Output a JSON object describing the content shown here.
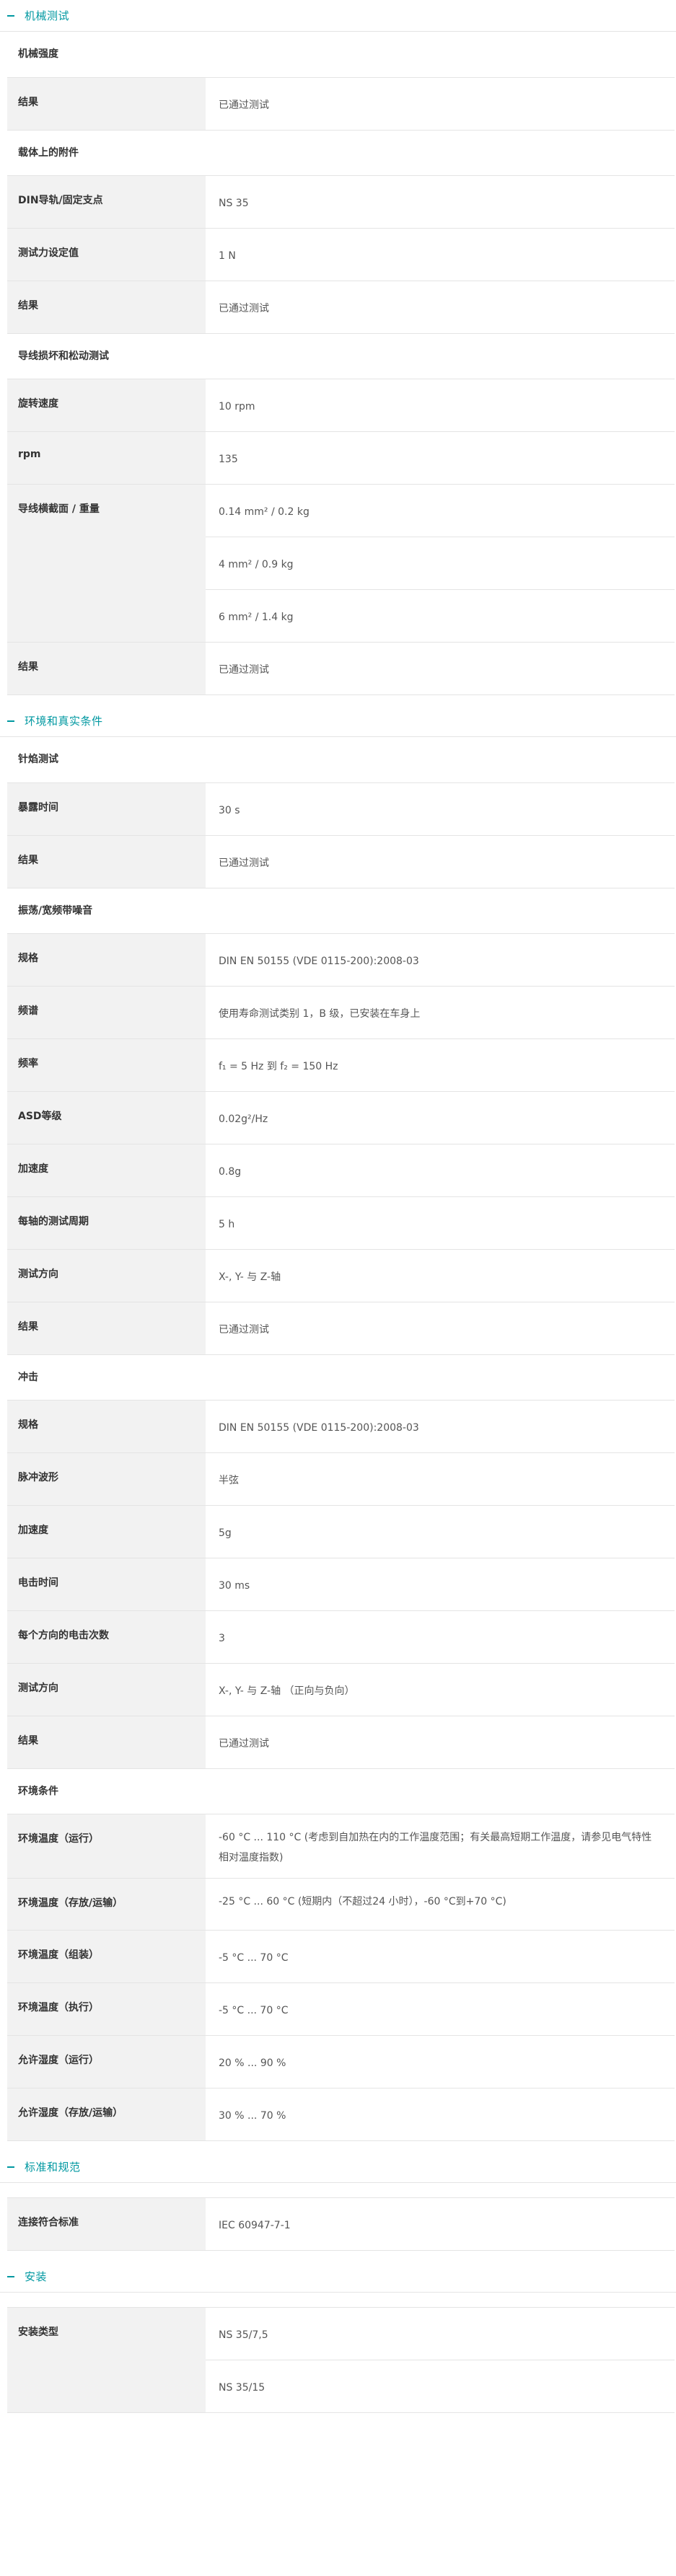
{
  "sections": [
    {
      "title": "机械测试",
      "groups": [
        {
          "title": "机械强度",
          "rows": [
            {
              "label": "结果",
              "values": [
                "已通过测试"
              ]
            }
          ]
        },
        {
          "title": "载体上的附件",
          "rows": [
            {
              "label": "DIN导轨/固定支点",
              "values": [
                "NS 35"
              ]
            },
            {
              "label": "测试力设定值",
              "values": [
                "1 N"
              ]
            },
            {
              "label": "结果",
              "values": [
                "已通过测试"
              ]
            }
          ]
        },
        {
          "title": "导线损坏和松动测试",
          "rows": [
            {
              "label": "旋转速度",
              "values": [
                "10 rpm"
              ]
            },
            {
              "label": "rpm",
              "values": [
                "135"
              ]
            },
            {
              "label": "导线横截面 / 重量",
              "values": [
                "0.14 mm² / 0.2 kg",
                "4 mm² / 0.9 kg",
                "6 mm² / 1.4 kg"
              ]
            },
            {
              "label": "结果",
              "values": [
                "已通过测试"
              ]
            }
          ]
        }
      ]
    },
    {
      "title": "环境和真实条件",
      "groups": [
        {
          "title": "针焰测试",
          "rows": [
            {
              "label": "暴露时间",
              "values": [
                "30 s"
              ]
            },
            {
              "label": "结果",
              "values": [
                "已通过测试"
              ]
            }
          ]
        },
        {
          "title": "振荡/宽频带噪音",
          "rows": [
            {
              "label": "规格",
              "values": [
                "DIN EN 50155 (VDE 0115-200):2008-03"
              ]
            },
            {
              "label": "频谱",
              "values": [
                "使用寿命测试类别 1，B 级，已安装在车身上"
              ]
            },
            {
              "label": "频率",
              "values": [
                "f₁ = 5 Hz 到 f₂ = 150 Hz"
              ]
            },
            {
              "label": "ASD等级",
              "values": [
                "0.02g²/Hz"
              ]
            },
            {
              "label": "加速度",
              "values": [
                "0.8g"
              ]
            },
            {
              "label": "每轴的测试周期",
              "values": [
                "5 h"
              ]
            },
            {
              "label": "测试方向",
              "values": [
                "X-, Y- 与 Z-轴"
              ]
            },
            {
              "label": "结果",
              "values": [
                "已通过测试"
              ]
            }
          ]
        },
        {
          "title": "冲击",
          "rows": [
            {
              "label": "规格",
              "values": [
                "DIN EN 50155 (VDE 0115-200):2008-03"
              ]
            },
            {
              "label": "脉冲波形",
              "values": [
                "半弦"
              ]
            },
            {
              "label": "加速度",
              "values": [
                "5g"
              ]
            },
            {
              "label": "电击时间",
              "values": [
                "30 ms"
              ]
            },
            {
              "label": "每个方向的电击次数",
              "values": [
                "3"
              ]
            },
            {
              "label": "测试方向",
              "values": [
                "X-, Y- 与 Z-轴 （正向与负向）"
              ]
            },
            {
              "label": "结果",
              "values": [
                "已通过测试"
              ]
            }
          ]
        },
        {
          "title": "环境条件",
          "rows": [
            {
              "label": "环境温度（运行）",
              "values": [
                "-60 °C ... 110 °C (考虑到自加热在内的工作温度范围；有关最高短期工作温度，请参见电气特性相对温度指数)"
              ]
            },
            {
              "label": "环境温度（存放/运输）",
              "values": [
                "-25 °C ... 60 °C (短期内（不超过24 小时），-60 °C到+70 °C)"
              ]
            },
            {
              "label": "环境温度（组装）",
              "values": [
                "-5 °C ... 70 °C"
              ]
            },
            {
              "label": "环境温度（执行）",
              "values": [
                "-5 °C ... 70 °C"
              ]
            },
            {
              "label": "允许湿度（运行）",
              "values": [
                "20 % ... 90 %"
              ]
            },
            {
              "label": "允许湿度（存放/运输）",
              "values": [
                "30 % ... 70 %"
              ]
            }
          ]
        }
      ]
    },
    {
      "title": "标准和规范",
      "groups": [
        {
          "title": "",
          "rows": [
            {
              "label": "连接符合标准",
              "values": [
                "IEC 60947-7-1"
              ]
            }
          ]
        }
      ]
    },
    {
      "title": "安装",
      "groups": [
        {
          "title": "",
          "rows": [
            {
              "label": "安装类型",
              "values": [
                "NS 35/7,5",
                "NS 35/15"
              ]
            }
          ]
        }
      ]
    }
  ]
}
